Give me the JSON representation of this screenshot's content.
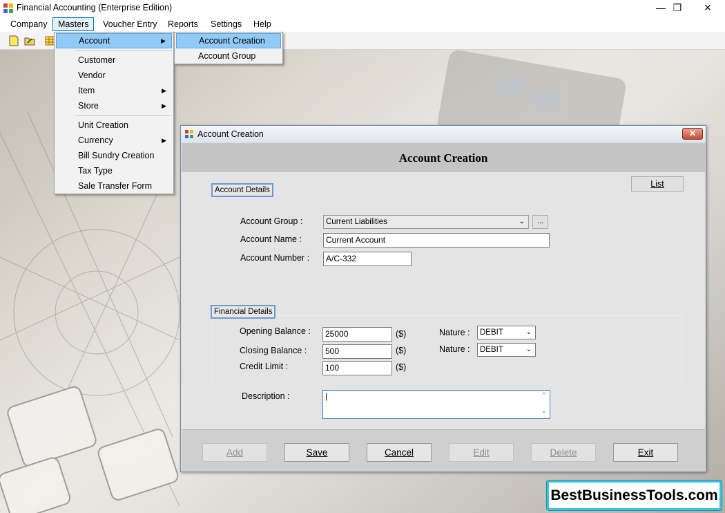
{
  "window": {
    "title": "Financial Accounting (Enterprise Edition)",
    "minimize": "—",
    "restore": "❐",
    "close": "✕"
  },
  "menubar": [
    "Company",
    "Masters",
    "Voucher Entry",
    "Reports",
    "Settings",
    "Help"
  ],
  "masters_menu": {
    "items": [
      "Account",
      "Customer",
      "Vendor",
      "Item",
      "Store",
      "Unit Creation",
      "Currency",
      "Bill Sundry Creation",
      "Tax Type",
      "Sale Transfer Form"
    ],
    "submenu_arrow": "▶"
  },
  "account_submenu": [
    "Account Creation",
    "Account Group"
  ],
  "dialog": {
    "title": "Account Creation",
    "heading": "Account Creation",
    "close": "✕",
    "list_button": "List",
    "account_details_label": "Account Details",
    "financial_details_label": "Financial Details",
    "account_group_label": "Account Group :",
    "account_group_value": "Current Liabilities",
    "browse_button": "...",
    "account_name_label": "Account Name :",
    "account_name_value": "Current Account",
    "account_number_label": "Account Number :",
    "account_number_value": "A/C-332",
    "opening_balance_label": "Opening Balance :",
    "opening_balance_value": "25000",
    "closing_balance_label": "Closing Balance :",
    "closing_balance_value": "500",
    "credit_limit_label": "Credit Limit :",
    "credit_limit_value": "100",
    "currency_unit": "($)",
    "nature_label": "Nature :",
    "nature_opening": "DEBIT",
    "nature_closing": "DEBIT",
    "description_label": "Description :",
    "description_value": "|",
    "scroll_up": "⌃",
    "scroll_down": "⌄",
    "combo_arrow": "⌄"
  },
  "buttons": {
    "add": "Add",
    "save": "Save",
    "cancel": "Cancel",
    "edit": "Edit",
    "delete": "Delete",
    "exit": "Exit"
  },
  "brand": "BestBusinessTools.com",
  "colors": {
    "accent": "#0078d7",
    "menu_highlight": "#91c9f7",
    "brand_border": "#3fc2dc"
  }
}
